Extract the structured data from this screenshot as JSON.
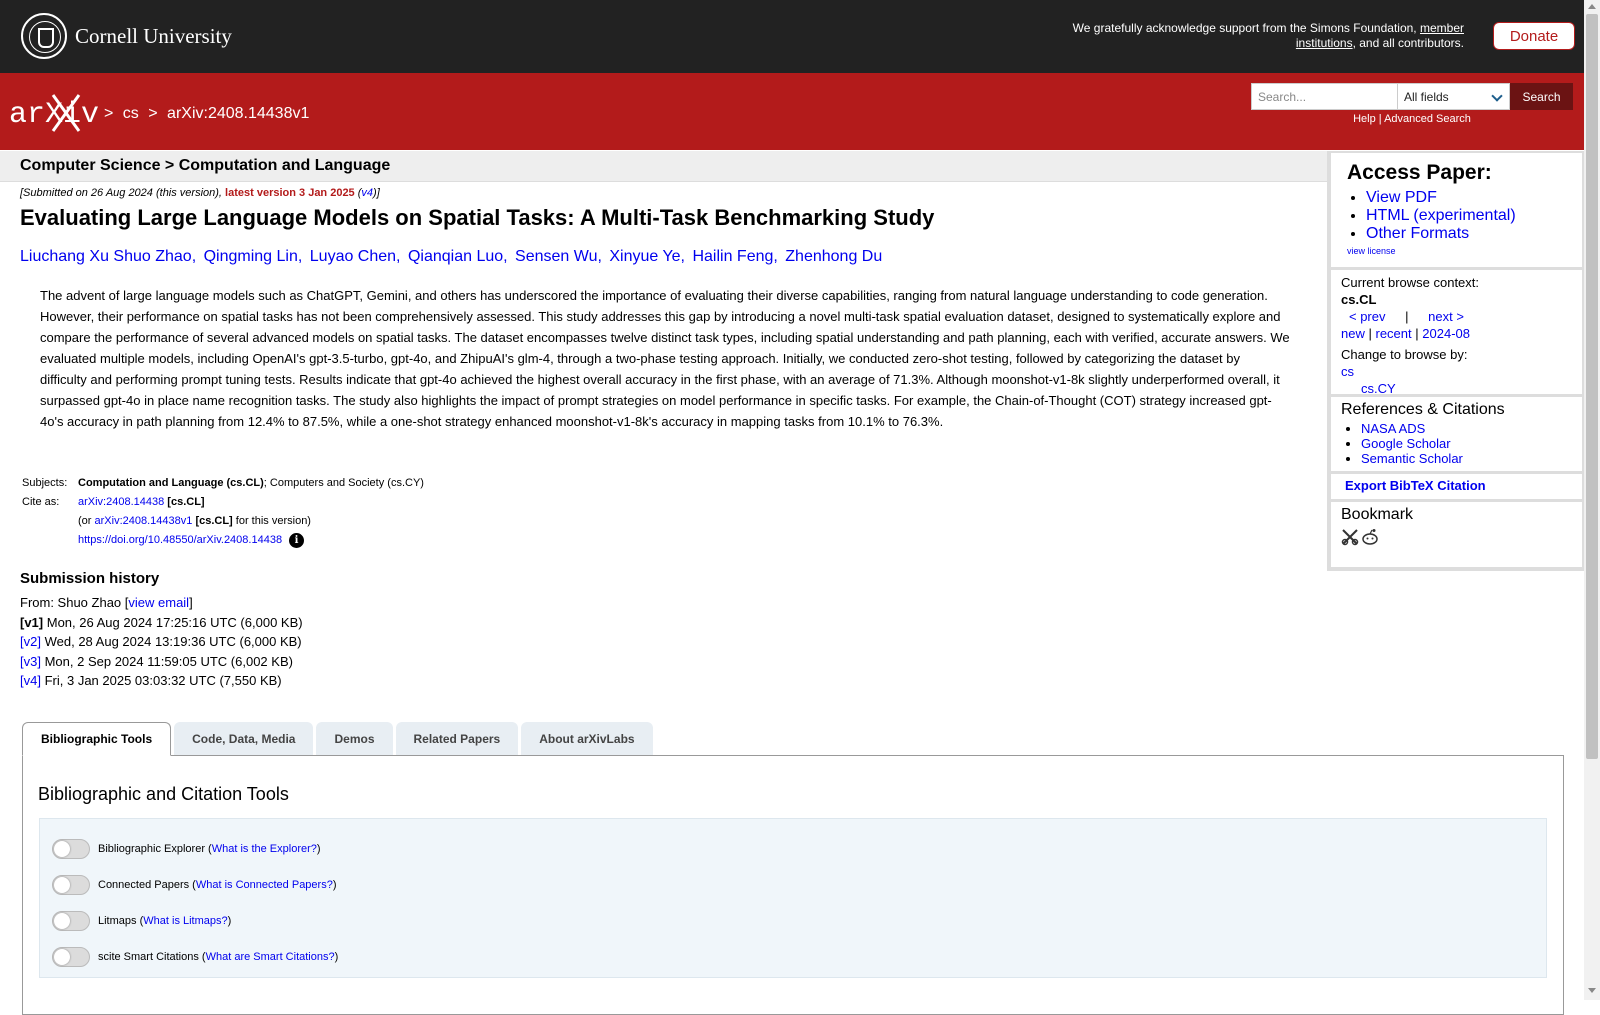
{
  "header": {
    "university": "Cornell University",
    "support_text": "We gratefully acknowledge support from the Simons Foundation,",
    "member_link": "member institutions",
    "support_suffix": ", and all contributors.",
    "donate_label": "Donate"
  },
  "nav": {
    "logo": "arXiv",
    "breadcrumb": [
      ">",
      "cs",
      ">",
      "arXiv:2408.14438v1"
    ],
    "search": {
      "placeholder": "Search...",
      "field": "All fields",
      "button": "Search"
    },
    "help": "Help",
    "separator": "|",
    "advanced": "Advanced Search"
  },
  "paper": {
    "category_heading": "Computer Science > Computation and Language",
    "submitted_prefix": "[Submitted on 26 Aug 2024 (this version), ",
    "latest": "latest version 3 Jan 2025",
    "version_open": " (",
    "version_link": "v4",
    "version_close": ")]",
    "title": "Evaluating Large Language Models on Spatial Tasks: A Multi-Task Benchmarking Study",
    "authors": [
      "Liuchang Xu Shuo Zhao,",
      "Qingming Lin,",
      "Luyao Chen,",
      "Qianqian Luo,",
      "Sensen Wu,",
      "Xinyue Ye,",
      "Hailin Feng,",
      "Zhenhong Du"
    ],
    "abstract": "The advent of large language models such as ChatGPT, Gemini, and others has underscored the importance of evaluating their diverse capabilities, ranging from natural language understanding to code generation. However, their performance on spatial tasks has not been comprehensively assessed. This study addresses this gap by introducing a novel multi-task spatial evaluation dataset, designed to systematically explore and compare the performance of several advanced models on spatial tasks. The dataset encompasses twelve distinct task types, including spatial understanding and path planning, each with verified, accurate answers. We evaluated multiple models, including OpenAI's gpt-3.5-turbo, gpt-4o, and ZhipuAI's glm-4, through a two-phase testing approach. Initially, we conducted zero-shot testing, followed by categorizing the dataset by difficulty and performing prompt tuning tests. Results indicate that gpt-4o achieved the highest overall accuracy in the first phase, with an average of 71.3%. Although moonshot-v1-8k slightly underperformed overall, it surpassed gpt-4o in place name recognition tasks. The study also highlights the impact of prompt strategies on model performance in specific tasks. For example, the Chain-of-Thought (COT) strategy increased gpt-4o's accuracy in path planning from 12.4% to 87.5%, while a one-shot strategy enhanced moonshot-v1-8k's accuracy in mapping tasks from 10.1% to 76.3%.",
    "subjects_label": "Subjects:",
    "subject_primary": "Computation and Language (cs.CL)",
    "subject_rest": "; Computers and Society (cs.CY)",
    "cite_label": "Cite as:",
    "cite_id": "arXiv:2408.14438",
    "cite_cat": "[cs.CL]",
    "cite_or": "(or",
    "cite_v1": "arXiv:2408.14438v1",
    "cite_v1_cat": "[cs.CL]",
    "cite_v1_suffix": "for this version)",
    "doi": "https://doi.org/10.48550/arXiv.2408.14438",
    "info_glyph": "i"
  },
  "history": {
    "title": "Submission history",
    "from_prefix": "From: Shuo Zhao [",
    "view_email": "view email",
    "from_suffix": "]",
    "versions": [
      {
        "label": "[v1]",
        "text": "Mon, 26 Aug 2024 17:25:16 UTC (6,000 KB)"
      },
      {
        "label": "[v2]",
        "text": "Wed, 28 Aug 2024 13:19:36 UTC (6,000 KB)"
      },
      {
        "label": "[v3]",
        "text": "Mon, 2 Sep 2024 11:59:05 UTC (6,002 KB)"
      },
      {
        "label": "[v4]",
        "text": "Fri, 3 Jan 2025 03:03:32 UTC (7,550 KB)"
      }
    ]
  },
  "tabs": [
    "Bibliographic Tools",
    "Code, Data, Media",
    "Demos",
    "Related Papers",
    "About arXivLabs"
  ],
  "tools": {
    "title": "Bibliographic and Citation Tools",
    "items": [
      {
        "name": "Bibliographic Explorer",
        "link": "What is the Explorer?"
      },
      {
        "name": "Connected Papers",
        "link": "What is Connected Papers?"
      },
      {
        "name": "Litmaps",
        "link": "What is Litmaps?"
      },
      {
        "name": "scite Smart Citations",
        "link": "What are Smart Citations?"
      }
    ]
  },
  "sidebar": {
    "access_title": "Access Paper:",
    "access_links": [
      "View PDF",
      "HTML (experimental)",
      "Other Formats"
    ],
    "license": "view license",
    "context_label": "Current browse context:",
    "context": "cs.CL",
    "prev": "< prev",
    "pipe": "|",
    "next": "next >",
    "new": "new",
    "recent": "recent",
    "month": "2024-08",
    "change_label": "Change to browse by:",
    "browse_cs": "cs",
    "browse_cy": "cs.CY",
    "refs_title": "References & Citations",
    "refs": [
      "NASA ADS",
      "Google Scholar",
      "Semantic Scholar"
    ],
    "bibtex": "Export BibTeX Citation",
    "bookmark": "Bookmark"
  },
  "colors": {
    "arxiv_red": "#b31b1b",
    "link_blue": "#0000ee",
    "top_black": "#222222"
  }
}
